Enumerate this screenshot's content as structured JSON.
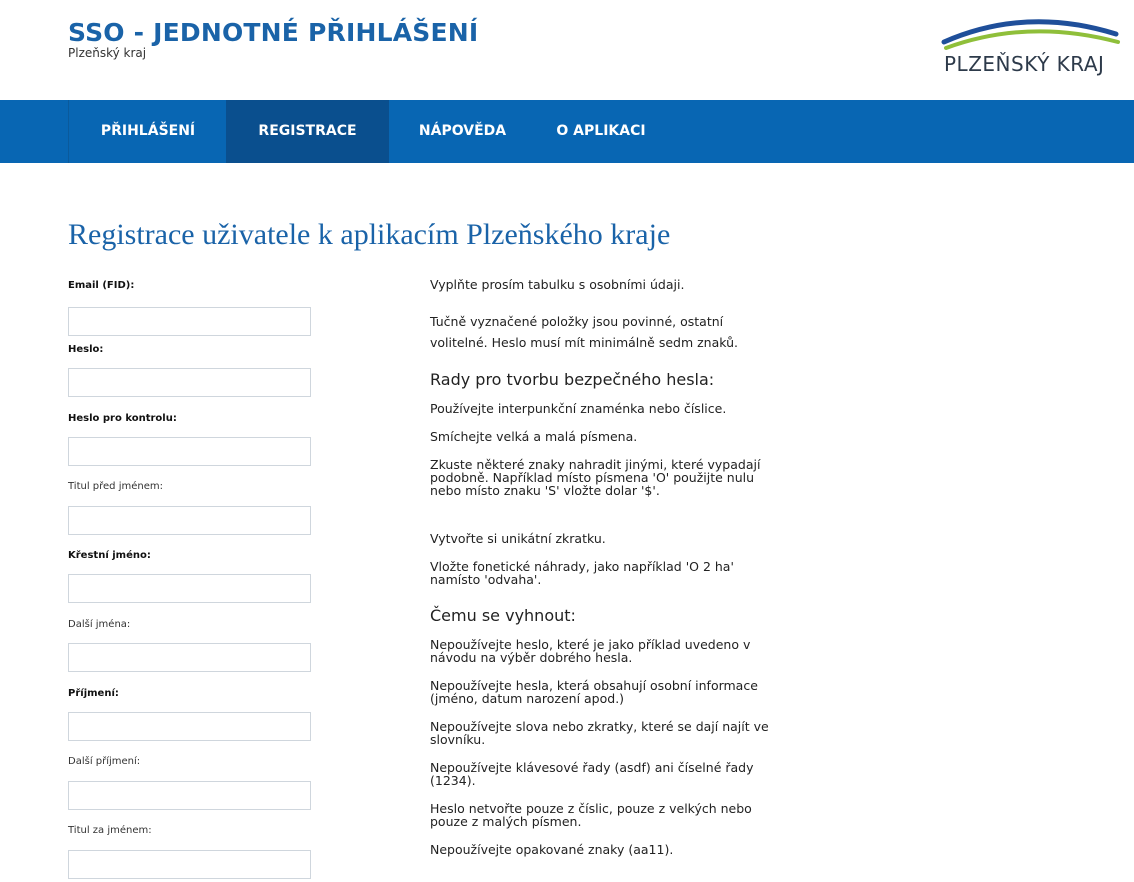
{
  "header": {
    "title": "SSO - JEDNOTNÉ PŘIHLÁŠENÍ",
    "subtitle": "Plzeňský kraj",
    "logo_text": "PLZEŇSKÝ KRAJ",
    "colors": {
      "nav_bg": "#0866b3",
      "nav_active": "#0a4f8e",
      "title": "#1a63a8",
      "logo_blue": "#1f4f9a",
      "logo_green": "#8fbf3a"
    }
  },
  "nav": {
    "items": [
      {
        "label": "PŘIHLÁŠENÍ",
        "active": false
      },
      {
        "label": "REGISTRACE",
        "active": true
      },
      {
        "label": "NÁPOVĚDA",
        "active": false
      },
      {
        "label": "O APLIKACI",
        "active": false
      }
    ]
  },
  "page": {
    "title": "Registrace uživatele k aplikacím Plzeňského kraje"
  },
  "form": {
    "fields": [
      {
        "label": "Email (FID):",
        "required": true,
        "value": ""
      },
      {
        "label": "Heslo:",
        "required": true,
        "value": ""
      },
      {
        "label": "Heslo pro kontrolu:",
        "required": true,
        "value": ""
      },
      {
        "label": "Titul před jménem:",
        "required": false,
        "value": ""
      },
      {
        "label": "Křestní jméno:",
        "required": true,
        "value": ""
      },
      {
        "label": "Další jména:",
        "required": false,
        "value": ""
      },
      {
        "label": "Příjmení:",
        "required": true,
        "value": ""
      },
      {
        "label": "Další příjmení:",
        "required": false,
        "value": ""
      },
      {
        "label": "Titul za jménem:",
        "required": false,
        "value": ""
      }
    ]
  },
  "info": {
    "intro": "Vyplňte prosím tabulku s osobními údaji.",
    "required_note": "Tučně vyznačené položky jsou povinné, ostatní volitelné. Heslo musí mít minimálně sedm znaků.",
    "tips_heading": "Rady pro tvorbu bezpečného hesla:",
    "tips": [
      "Používejte interpunkční znaménka nebo číslice.",
      "Smíchejte velká a malá písmena.",
      "Zkuste některé znaky nahradit jinými, které vypadají podobně. Například místo písmena 'O' použijte nulu nebo místo znaku 'S' vložte dolar '$'.",
      "Vytvořte si unikátní zkratku.",
      "Vložte fonetické náhrady, jako například 'O 2 ha' namísto 'odvaha'."
    ],
    "avoid_heading": "Čemu se vyhnout:",
    "avoid": [
      "Nepoužívejte heslo, které je jako příklad uvedeno v návodu na výběr dobrého hesla.",
      "Nepoužívejte hesla, která obsahují osobní informace (jméno, datum narození apod.)",
      "Nepoužívejte slova nebo zkratky, které se dají najít ve slovníku.",
      "Nepoužívejte klávesové řady (asdf) ani číselné řady (1234).",
      "Heslo netvořte pouze z číslic, pouze z velkých nebo pouze z malých písmen.",
      "Nepoužívejte opakované znaky (aa11)."
    ]
  }
}
